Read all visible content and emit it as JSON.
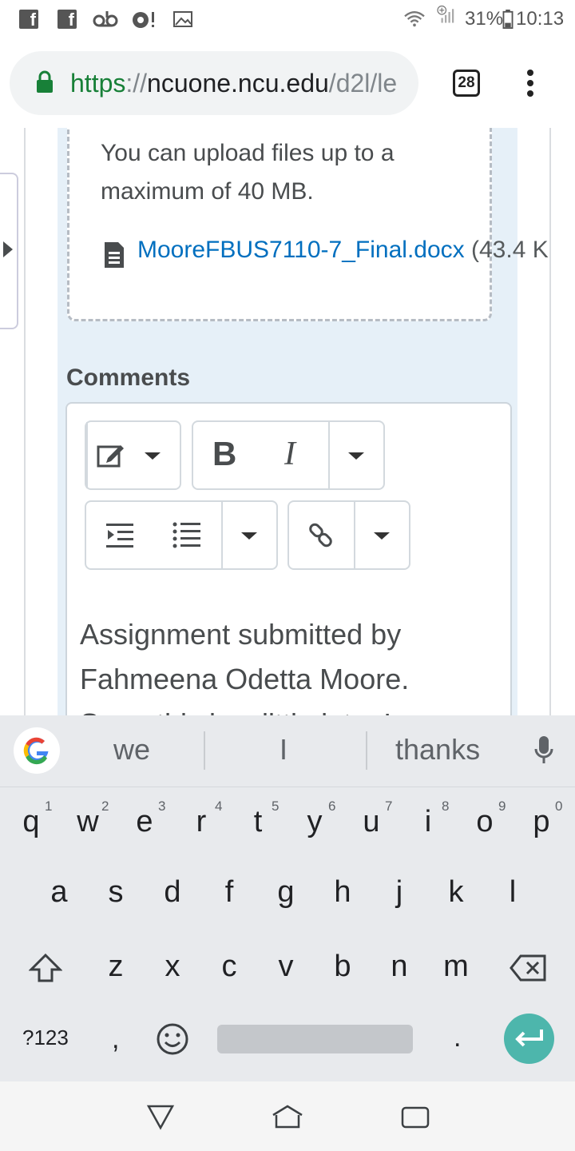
{
  "status_bar": {
    "battery": "31%",
    "time": "10:13"
  },
  "browser": {
    "url_scheme": "https",
    "url_sep": "://",
    "url_host": "ncuone.ncu.edu",
    "url_path": "/d2l/le",
    "tab_count": "28"
  },
  "upload": {
    "limit_text": "You can upload files up to a maximum of 40 MB.",
    "file_name": "MooreFBUS7110-7_Final.docx",
    "file_size": "(43.4 K"
  },
  "comments": {
    "label": "Comments",
    "editor_text_line1": "Assignment submitted by",
    "editor_text_line2": "Fahmeena Odetta Moore.",
    "editor_text_line3": "Sorry this is a little late. I"
  },
  "toolbar": {
    "bold_label": "B",
    "italic_label": "I"
  },
  "keyboard": {
    "suggestions": [
      "we",
      "I",
      "thanks"
    ],
    "row1": [
      "q",
      "w",
      "e",
      "r",
      "t",
      "y",
      "u",
      "i",
      "o",
      "p"
    ],
    "row1_hints": [
      "1",
      "2",
      "3",
      "4",
      "5",
      "6",
      "7",
      "8",
      "9",
      "0"
    ],
    "row2": [
      "a",
      "s",
      "d",
      "f",
      "g",
      "h",
      "j",
      "k",
      "l"
    ],
    "row3": [
      "z",
      "x",
      "c",
      "v",
      "b",
      "n",
      "m"
    ],
    "symbols_label": "?123",
    "comma": ",",
    "period": ".",
    "accent_color": "#4db6ac"
  }
}
